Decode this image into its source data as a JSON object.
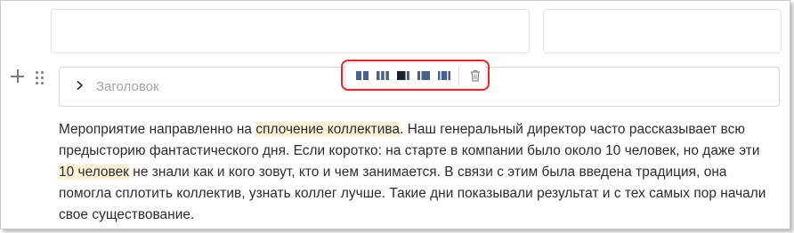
{
  "editor": {
    "heading_placeholder": "Заголовок",
    "toolbar": {
      "buttons": [
        "layout-half-half-icon",
        "layout-thirds-icon",
        "layout-wide-left-icon",
        "layout-wide-right-icon",
        "layout-center-icon"
      ],
      "delete": "trash-icon",
      "highlight_color": "#e0282e"
    }
  },
  "paragraph": {
    "seg1": "Мероприятие направленно на ",
    "hl1": "сплочение коллектива",
    "seg2": ". Наш генеральный директор часто рассказывает всю предысторию фантастического дня. Если коротко: на старте в компании было около 10 человек, но даже эти ",
    "hl2": "10 человек",
    "seg3": " не знали как и кого зовут, кто и чем занимается. В связи с этим была введена традиция, она помогла сплотить коллектив, узнать коллег лучше. Такие дни показывали результат и с тех самых пор начали свое существование.",
    "highlight_color": "#fdf0d7"
  }
}
